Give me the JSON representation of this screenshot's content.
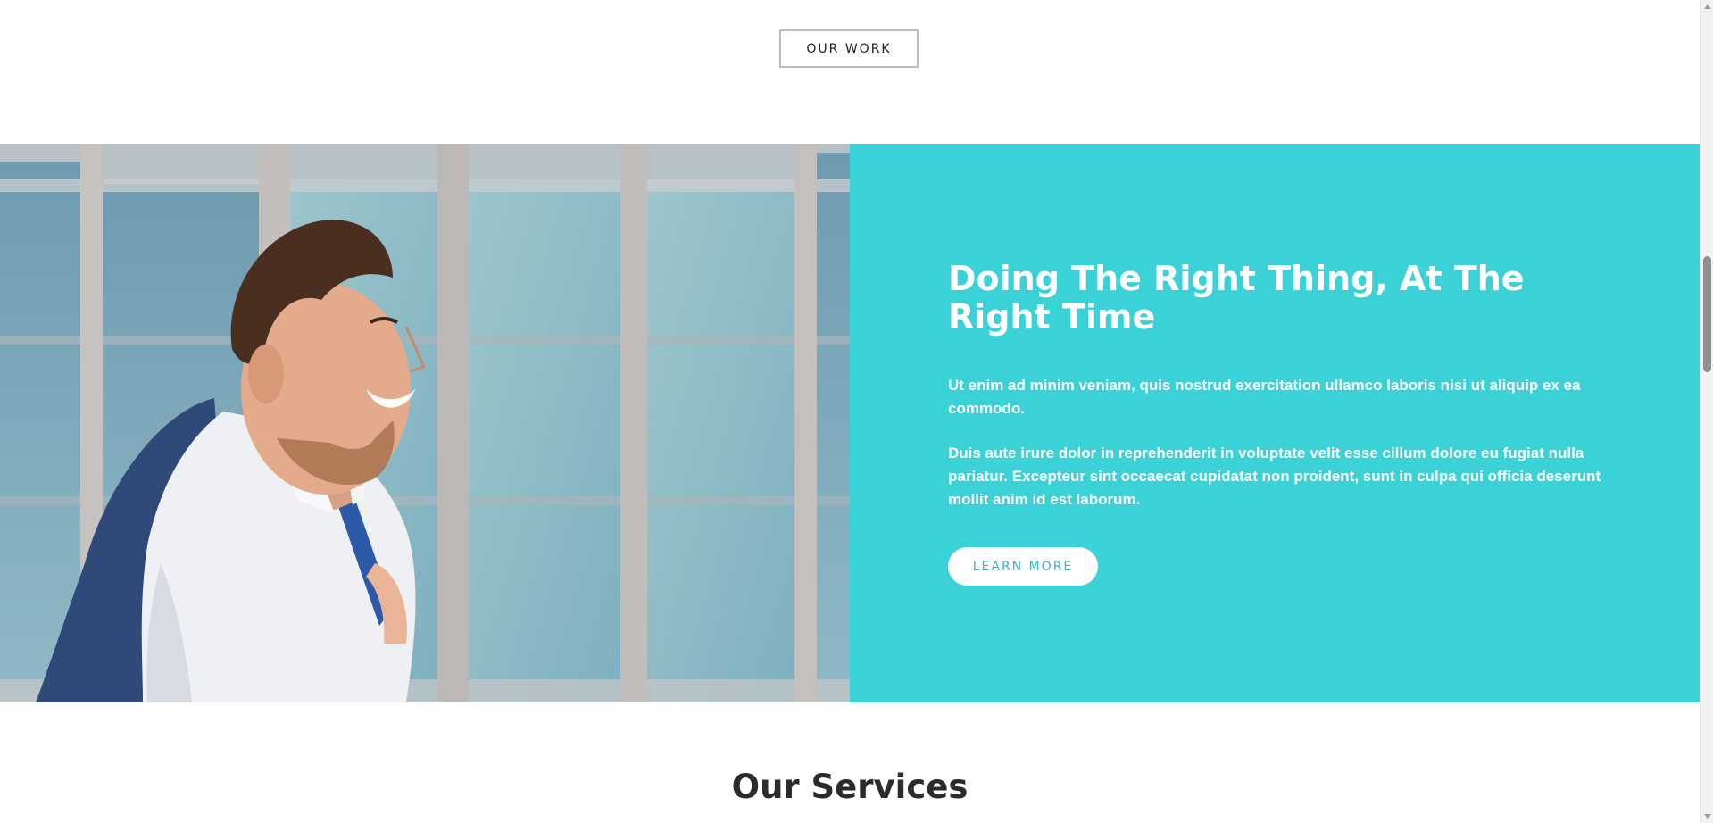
{
  "our_work": {
    "label": "OUR WORK"
  },
  "feature": {
    "title": "Doing The Right Thing, At The Right Time",
    "paragraph1": "Ut enim ad minim veniam, quis nostrud exercitation ullamco laboris nisi ut aliquip ex ea commodo.",
    "paragraph2": "Duis aute irure dolor in reprehenderit in voluptate velit esse cillum dolore eu fugiat nulla pariatur. Excepteur sint occaecat cupidatat non proident, sunt in culpa qui officia deserunt mollit anim id est laborum.",
    "button_label": "LEARN MORE",
    "accent_color": "#3ad2d7"
  },
  "services": {
    "title": "Our Services"
  }
}
